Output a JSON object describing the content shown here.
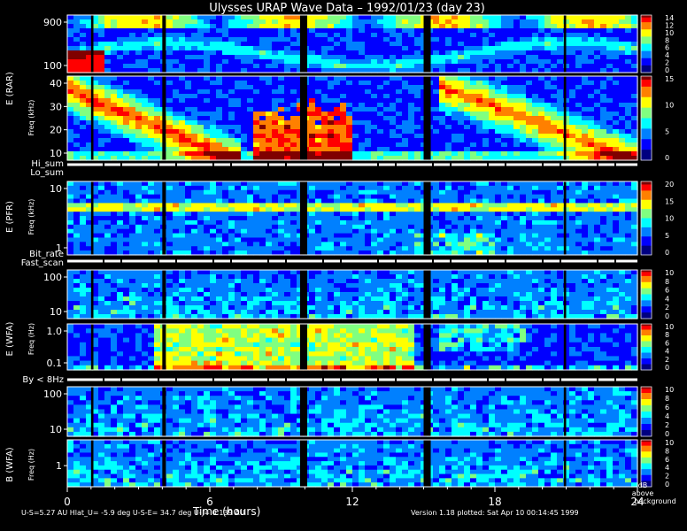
{
  "title": "Ulysses URAP Wave Data – 1992/01/23  (day 23)",
  "colors": {
    "background": "#000000",
    "text": "#ffffff",
    "palette": [
      "#000080",
      "#0000ff",
      "#0080ff",
      "#00ffff",
      "#80ff80",
      "#ffff00",
      "#ff8000",
      "#ff0000",
      "#800000"
    ]
  },
  "chart_data": {
    "type": "heatmap",
    "x": {
      "label": "Time (hours)",
      "range": [
        0,
        24
      ],
      "ticks": [
        "0",
        "6",
        "12",
        "18",
        "24"
      ],
      "minor_step": 1
    },
    "data_gaps_hours": [
      [
        1.0,
        1.1
      ],
      [
        4.0,
        4.15
      ],
      [
        9.8,
        10.1
      ],
      [
        15.0,
        15.3
      ],
      [
        20.9,
        21.0
      ]
    ],
    "panels": [
      {
        "id": "rar",
        "left_label": "E (RAR)",
        "freq_label": "",
        "y_scale": "log",
        "y_range_khz": [
          60,
          1000
        ],
        "y_ticks": [
          "900",
          "100"
        ],
        "colorbar": {
          "range": [
            0,
            14
          ],
          "ticks": [
            "14",
            "12",
            "10",
            "8",
            "6",
            "4",
            "2",
            "0"
          ]
        }
      },
      {
        "id": "rar-lin",
        "left_label": "",
        "freq_label": "Freq (kHz)",
        "y_scale": "linear",
        "y_range_khz": [
          0,
          48
        ],
        "y_ticks": [
          "40",
          "30",
          "20",
          "10"
        ],
        "colorbar": {
          "range": [
            0,
            16
          ],
          "ticks": [
            "15",
            "10",
            "5",
            "0"
          ]
        }
      },
      {
        "id": "pfr",
        "left_label": "E (PFR)",
        "freq_label": "Freq (kHz)",
        "y_scale": "log",
        "y_range_khz": [
          0.6,
          30
        ],
        "y_ticks": [
          "10",
          "1"
        ],
        "colorbar": {
          "range": [
            0,
            20
          ],
          "ticks": [
            "20",
            "15",
            "10",
            "5",
            "0"
          ]
        }
      },
      {
        "id": "wfa-e-high",
        "left_label": "E (WFA)",
        "freq_label": "",
        "y_scale": "log",
        "y_range_hz": [
          8,
          500
        ],
        "y_ticks": [
          "100",
          "10"
        ],
        "colorbar": {
          "range": [
            0,
            10
          ],
          "ticks": [
            "10",
            "8",
            "6",
            "4",
            "2",
            "0"
          ]
        }
      },
      {
        "id": "wfa-e-low",
        "left_label": "",
        "freq_label": "Freq (Hz)",
        "y_scale": "log",
        "y_range_hz": [
          0.08,
          6
        ],
        "y_ticks": [
          "1.0",
          "0.1"
        ],
        "colorbar": {
          "range": [
            0,
            10
          ],
          "ticks": [
            "10",
            "8",
            "6",
            "4",
            "2",
            "0"
          ]
        }
      },
      {
        "id": "wfa-b-high",
        "left_label": "",
        "freq_label": "",
        "y_scale": "log",
        "y_range_hz": [
          8,
          500
        ],
        "y_ticks": [
          "100",
          "10"
        ],
        "colorbar": {
          "range": [
            0,
            10
          ],
          "ticks": [
            "10",
            "8",
            "6",
            "4",
            "2",
            "0"
          ]
        }
      },
      {
        "id": "wfa-b-low",
        "left_label": "B (WFA)",
        "freq_label": "Freq (Hz)",
        "y_scale": "log",
        "y_range_hz": [
          0.08,
          6
        ],
        "y_ticks": [
          "1"
        ],
        "colorbar": {
          "range": [
            0,
            10
          ],
          "ticks": [
            "10",
            "8",
            "6",
            "4",
            "2",
            "0"
          ]
        }
      }
    ],
    "strips": [
      {
        "id": "hi-lo-sum",
        "labels": [
          "Hi_sum",
          "Lo_sum"
        ]
      },
      {
        "id": "bitrate-fastscan",
        "labels": [
          "Bit_rate",
          "Fast_scan"
        ]
      },
      {
        "id": "by-8hz",
        "labels": [
          "By < 8Hz"
        ]
      }
    ],
    "colorbar_unit_lines": [
      "dB",
      "above",
      "background"
    ]
  },
  "footer": {
    "ephemeris": "U-S=5.27 AU   Hlat_U= -5.9 deg   U-S-E= 34.7 deg   U-J= 0.139 AU",
    "version": "Version 1.18 plotted: Sat Apr 10 00:14:45 1999"
  }
}
